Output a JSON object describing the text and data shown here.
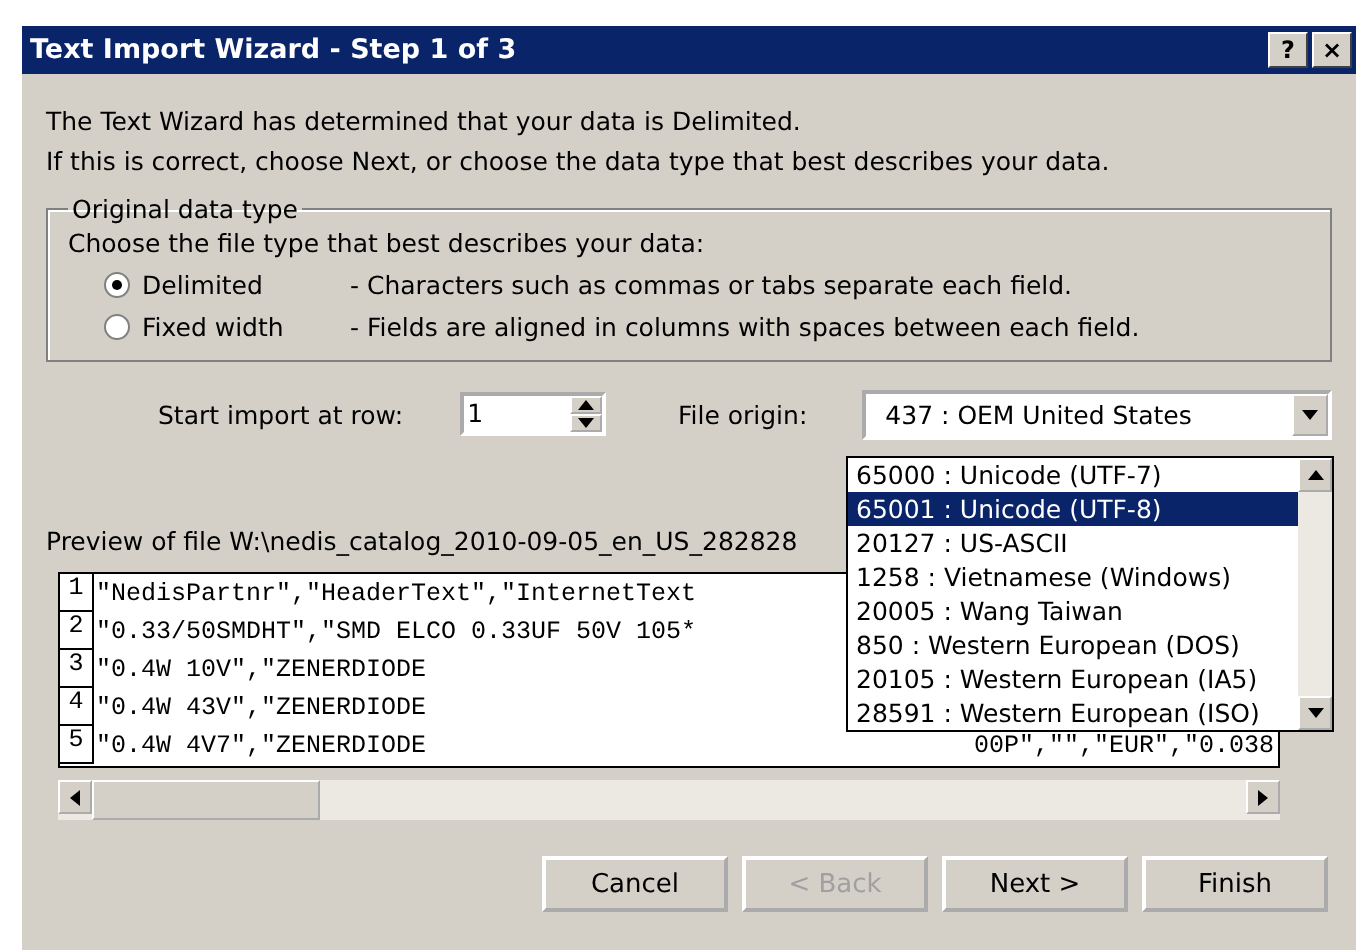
{
  "window": {
    "title": "Text Import Wizard - Step 1 of 3",
    "buttons": [
      "?",
      "×"
    ]
  },
  "intro": [
    "The Text Wizard has determined that your data is Delimited.",
    "If this is correct, choose Next, or choose the data type that best describes your data."
  ],
  "group": {
    "title": "Original data type",
    "prompt": "Choose the file type that best describes your data:",
    "options": [
      {
        "label": "Delimited",
        "description": "- Characters such as commas or tabs separate each field.",
        "selected": true
      },
      {
        "label": "Fixed width",
        "description": "- Fields are aligned in columns with spaces between each field.",
        "selected": false
      }
    ]
  },
  "start_row": {
    "label": "Start import at row:",
    "value": "1"
  },
  "file_origin": {
    "label": "File origin:",
    "value": "437 : OEM United States",
    "expanded": true,
    "options": [
      {
        "label": "65000 : Unicode (UTF-7)",
        "selected": false
      },
      {
        "label": "65001 : Unicode (UTF-8)",
        "selected": true
      },
      {
        "label": "20127 : US-ASCII",
        "selected": false
      },
      {
        "label": "1258 : Vietnamese (Windows)",
        "selected": false
      },
      {
        "label": "20005 : Wang Taiwan",
        "selected": false
      },
      {
        "label": "850 : Western European (DOS)",
        "selected": false
      },
      {
        "label": "20105 : Western European (IA5)",
        "selected": false
      },
      {
        "label": "28591 : Western European (ISO)",
        "selected": false
      }
    ]
  },
  "preview": {
    "label": "Preview of file W:\\nedis_catalog_2010-09-05_en_US_282828",
    "rows": [
      {
        "number": "1",
        "text": "\"NedisPartnr\",\"HeaderText\",\"InternetText",
        "tail": ""
      },
      {
        "number": "2",
        "text": "\"0.33/50SMDHT\",\"SMD ELCO 0.33UF 50V 105*",
        "tail": ""
      },
      {
        "number": "3",
        "text": "\"0.4W 10V\",\"ZENERDIODE",
        "tail": ""
      },
      {
        "number": "4",
        "text": "\"0.4W 43V\",\"ZENERDIODE",
        "tail": ""
      },
      {
        "number": "5",
        "text": "\"0.4W 4V7\",\"ZENERDIODE",
        "tail": "00P\",\"\",\"EUR\",\"0.038"
      }
    ]
  },
  "buttons": [
    {
      "label": "Cancel",
      "disabled": false
    },
    {
      "label": "< Back",
      "disabled": true
    },
    {
      "label": "Next >",
      "disabled": false
    },
    {
      "label": "Finish",
      "disabled": false
    }
  ]
}
